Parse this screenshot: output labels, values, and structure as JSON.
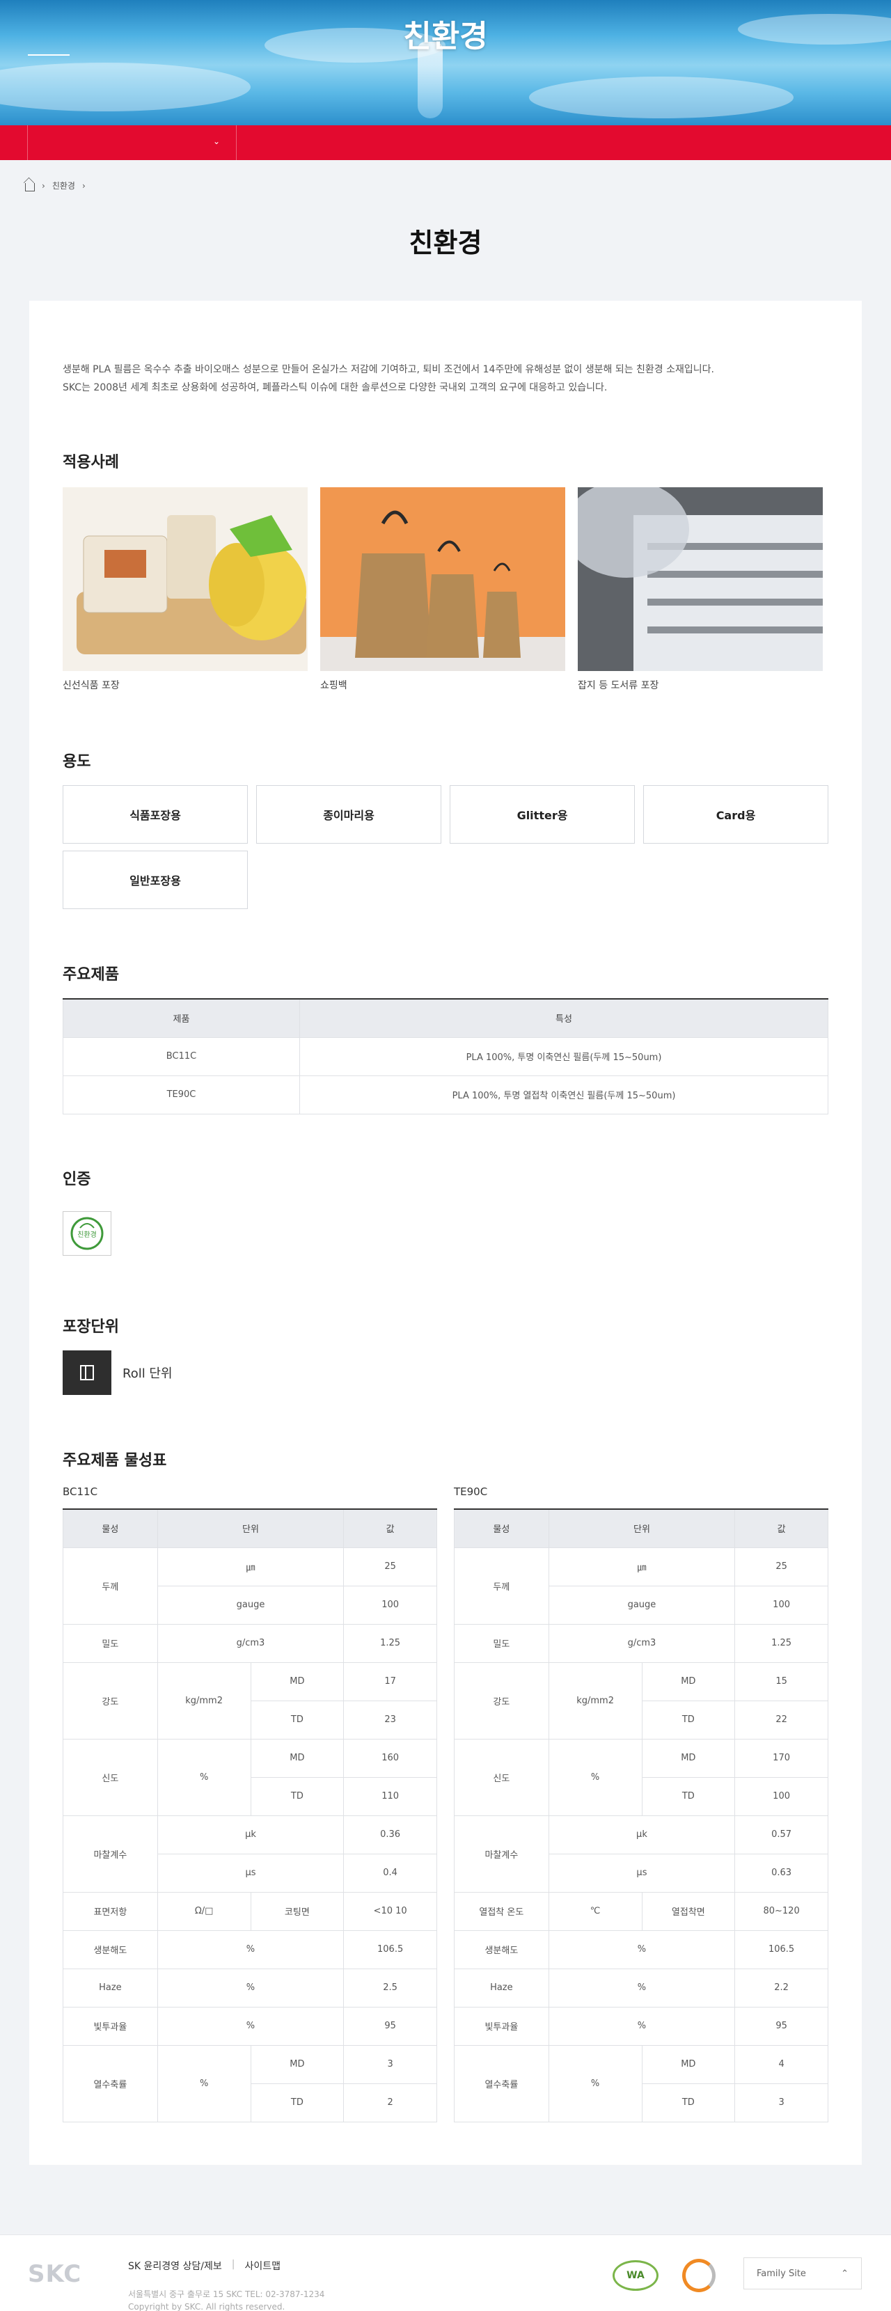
{
  "header": {
    "title": "친환경"
  },
  "breadcrumb": {
    "current": "친환경",
    "separator": "›"
  },
  "page": {
    "title": "친환경",
    "intro_line1": "생분해 PLA 필름은 옥수수 추출 바이오매스 성분으로 만들어 온실가스 저감에 기여하고, 퇴비 조건에서 14주만에 유해성분 없이 생분해 되는 친환경 소재입니다.",
    "intro_line2": "SKC는 2008년 세계 최초로 상용화에 성공하여, 폐플라스틱 이슈에 대한 솔루션으로 다양한 국내외 고객의 요구에 대응하고 있습니다."
  },
  "cases": {
    "title": "적용사례",
    "items": [
      {
        "caption": "신선식품 포장"
      },
      {
        "caption": "쇼핑백"
      },
      {
        "caption": "잡지 등 도서류 포장"
      }
    ]
  },
  "usage": {
    "title": "용도",
    "items": [
      "식품포장용",
      "종이마리용",
      "Glitter용",
      "Card용",
      "일반포장용"
    ]
  },
  "products": {
    "title": "주요제품",
    "headers": [
      "제품",
      "특성"
    ],
    "rows": [
      [
        "BC11C",
        "PLA 100%, 투명 이축연신 필름(두께 15~50um)"
      ],
      [
        "TE90C",
        "PLA 100%, 투명 열접착 이축연신 필름(두께 15~50um)"
      ]
    ]
  },
  "certification": {
    "title": "인증",
    "mark_text": "친환경"
  },
  "packaging": {
    "title": "포장단위",
    "unit": "Roll 단위"
  },
  "properties": {
    "title": "주요제품 물성표",
    "headers": [
      "물성",
      "단위",
      "값"
    ],
    "labels": {
      "thickness": "두께",
      "density": "밀도",
      "strength": "강도",
      "elongation": "신도",
      "friction": "마찰계수",
      "biodeg": "생분해도",
      "haze": "Haze",
      "transmit": "빛투과율",
      "shrink": "열수축률"
    },
    "units": {
      "um": "㎛",
      "gauge": "gauge",
      "gcm3": "g/cm3",
      "kgmm2": "kg/mm2",
      "pct": "%",
      "md": "MD",
      "td": "TD",
      "uk": "μk",
      "us": "μs",
      "ohm": "Ω/□",
      "coated": "코팅면",
      "celsius": "℃",
      "sealside": "열접착면"
    },
    "bc11c": {
      "name": "BC11C",
      "thick_um": "25",
      "thick_gauge": "100",
      "density": "1.25",
      "str_md": "17",
      "str_td": "23",
      "elo_md": "160",
      "elo_td": "110",
      "uk": "0.36",
      "us": "0.4",
      "surface_label": "표면저항",
      "surface": "<10 10",
      "biodeg": "106.5",
      "haze": "2.5",
      "transmit": "95",
      "shr_md": "3",
      "shr_td": "2"
    },
    "te90c": {
      "name": "TE90C",
      "thick_um": "25",
      "thick_gauge": "100",
      "density": "1.25",
      "str_md": "15",
      "str_td": "22",
      "elo_md": "170",
      "elo_td": "100",
      "uk": "0.57",
      "us": "0.63",
      "seal_label": "열접착 온도",
      "seal": "80~120",
      "biodeg": "106.5",
      "haze": "2.2",
      "transmit": "95",
      "shr_md": "4",
      "shr_td": "3"
    }
  },
  "footer": {
    "logo": "SKC",
    "menu1": "SK 윤리경영 상담/제보",
    "menu_sep": "|",
    "menu2": "사이트맵",
    "address": "서울특별시 중구 출무로 15 SKC TEL: 02-3787-1234",
    "copyright": "Copyright by SKC. All rights reserved.",
    "badge": "WA",
    "family_site": "Family Site"
  }
}
